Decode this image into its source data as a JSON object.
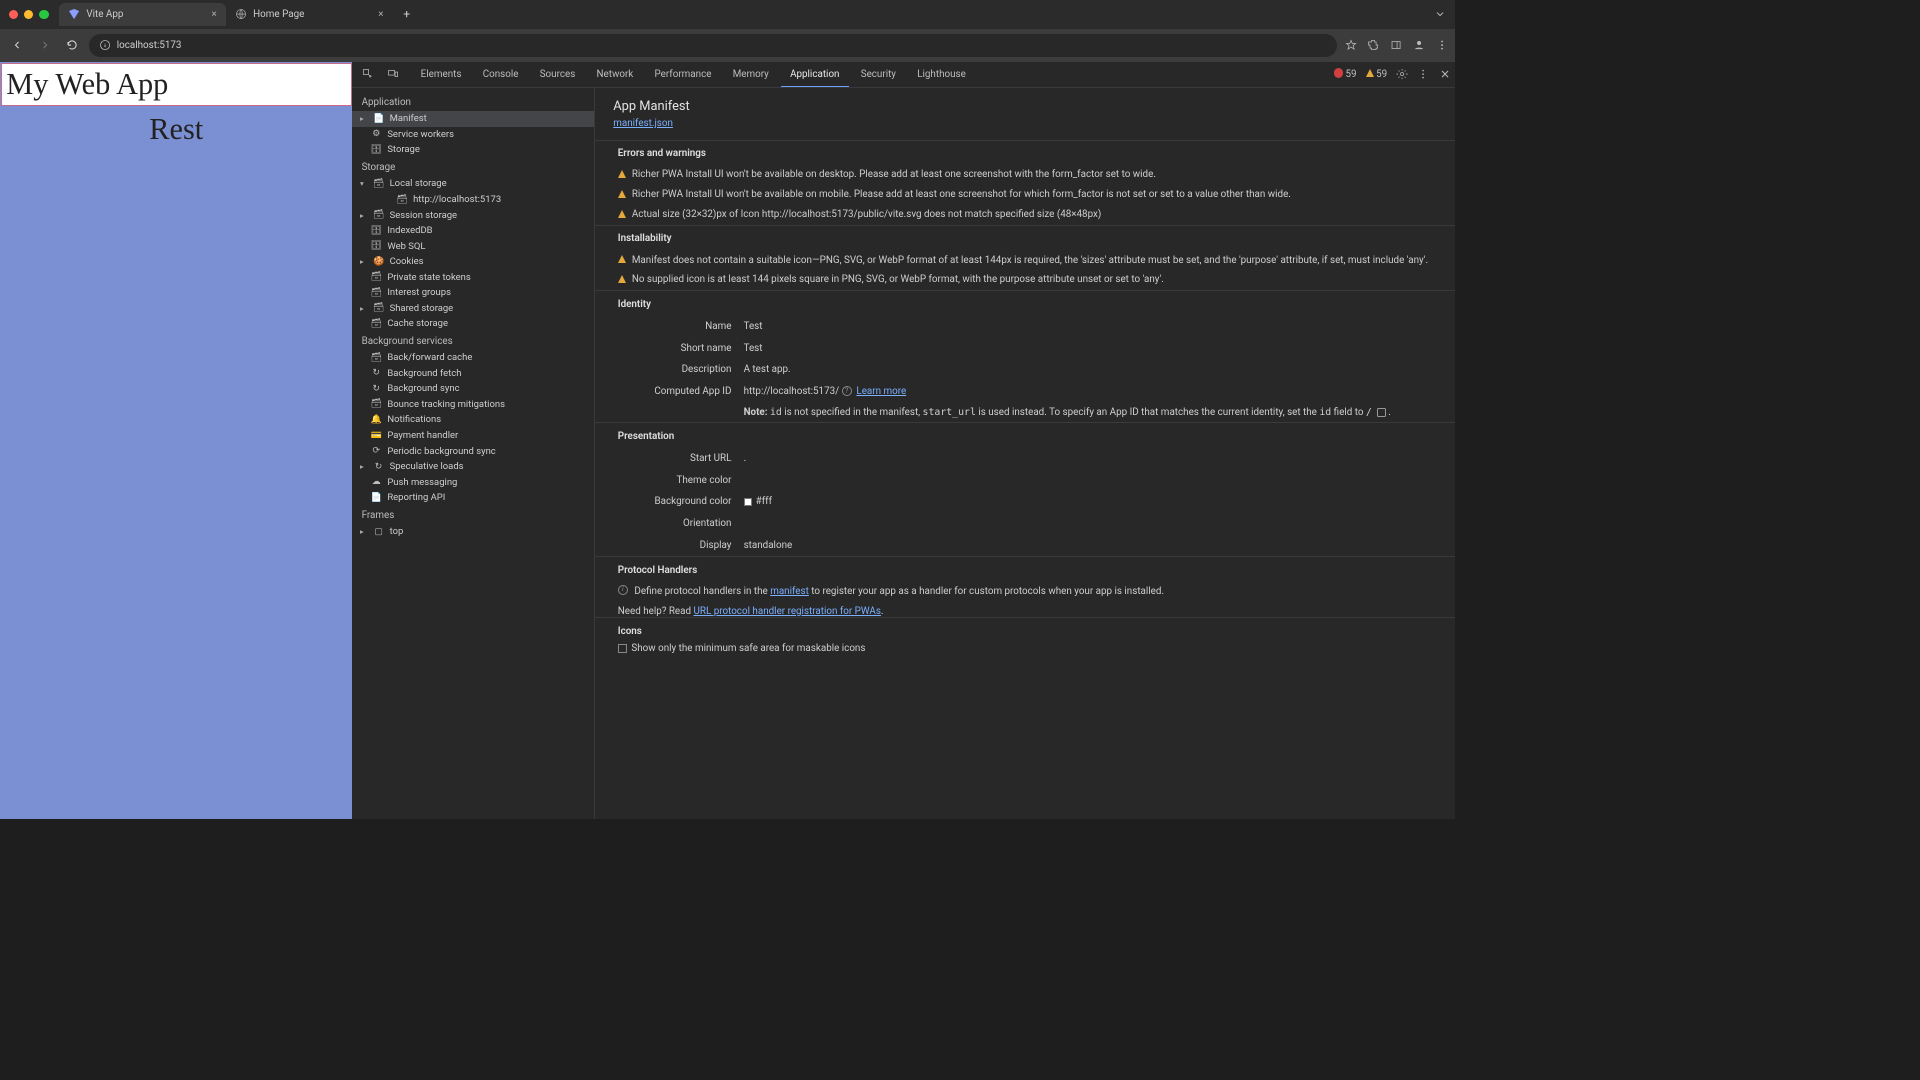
{
  "chrome": {
    "tabs": [
      {
        "title": "Vite App",
        "active": true
      },
      {
        "title": "Home Page",
        "active": false
      }
    ],
    "address": "localhost:5173"
  },
  "page": {
    "title": "My Web App",
    "subtitle": "Rest"
  },
  "devtools": {
    "tabs": [
      "Elements",
      "Console",
      "Sources",
      "Network",
      "Performance",
      "Memory",
      "Application",
      "Security",
      "Lighthouse"
    ],
    "active_tab": "Application",
    "error_count": "59",
    "warn_count": "59",
    "sidebar": {
      "application": {
        "label": "Application",
        "items": {
          "manifest": "Manifest",
          "service_workers": "Service workers",
          "storage": "Storage"
        }
      },
      "storage": {
        "label": "Storage",
        "items": {
          "local_storage": "Local storage",
          "local_storage_origin": "http://localhost:5173",
          "session_storage": "Session storage",
          "indexeddb": "IndexedDB",
          "websql": "Web SQL",
          "cookies": "Cookies",
          "private_state_tokens": "Private state tokens",
          "interest_groups": "Interest groups",
          "shared_storage": "Shared storage",
          "cache_storage": "Cache storage"
        }
      },
      "bg_services": {
        "label": "Background services",
        "items": {
          "bf_cache": "Back/forward cache",
          "bg_fetch": "Background fetch",
          "bg_sync": "Background sync",
          "bounce": "Bounce tracking mitigations",
          "notifications": "Notifications",
          "payment": "Payment handler",
          "periodic_sync": "Periodic background sync",
          "speculative": "Speculative loads",
          "push": "Push messaging",
          "reporting": "Reporting API"
        }
      },
      "frames": {
        "label": "Frames",
        "top": "top"
      }
    },
    "manifest": {
      "title": "App Manifest",
      "file_link": "manifest.json",
      "errors_hdr": "Errors and warnings",
      "warnings": {
        "w1": "Richer PWA Install UI won't be available on desktop. Please add at least one screenshot with the form_factor set to wide.",
        "w2": "Richer PWA Install UI won't be available on mobile. Please add at least one screenshot for which form_factor is not set or set to a value other than wide.",
        "w3": "Actual size (32×32)px of Icon http://localhost:5173/public/vite.svg does not match specified size (48×48px)"
      },
      "installability_hdr": "Installability",
      "install_warnings": {
        "i1": "Manifest does not contain a suitable icon—PNG, SVG, or WebP format of at least 144px is required, the 'sizes' attribute must be set, and the 'purpose' attribute, if set, must include 'any'.",
        "i2": "No supplied icon is at least 144 pixels square in PNG, SVG, or WebP format, with the purpose attribute unset or set to 'any'."
      },
      "identity_hdr": "Identity",
      "identity": {
        "name_k": "Name",
        "name_v": "Test",
        "short_k": "Short name",
        "short_v": "Test",
        "desc_k": "Description",
        "desc_v": "A test app.",
        "appid_k": "Computed App ID",
        "appid_v": "http://localhost:5173/",
        "learn_more": "Learn more",
        "note_pre": "Note:",
        "note_id": "id",
        "note_mid1": " is not specified in the manifest, ",
        "note_start": "start_url",
        "note_mid2": " is used instead. To specify an App ID that matches the current identity, set the ",
        "note_id2": "id",
        "note_mid3": " field to ",
        "note_slash": "/",
        "note_end": " ."
      },
      "presentation_hdr": "Presentation",
      "presentation": {
        "start_k": "Start URL",
        "start_v": ".",
        "theme_k": "Theme color",
        "theme_v": "",
        "bg_k": "Background color",
        "bg_v": "#fff",
        "orient_k": "Orientation",
        "orient_v": "",
        "display_k": "Display",
        "display_v": "standalone"
      },
      "protocol_hdr": "Protocol Handlers",
      "protocol": {
        "info_pre": "Define protocol handlers in the ",
        "info_link": "manifest",
        "info_post": " to register your app as a handler for custom protocols when your app is installed.",
        "help_pre": "Need help? Read ",
        "help_link": "URL protocol handler registration for PWAs",
        "help_post": "."
      },
      "icons_hdr": "Icons",
      "icons_check": "Show only the minimum safe area for maskable icons"
    }
  }
}
